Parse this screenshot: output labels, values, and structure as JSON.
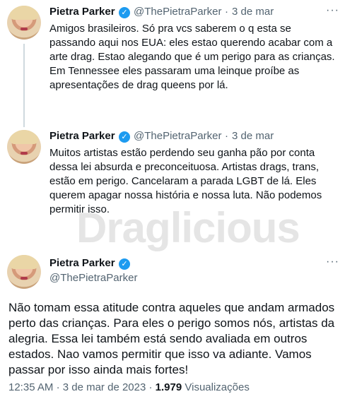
{
  "tweets": [
    {
      "name": "Pietra Parker",
      "handle": "@ThePietraParker",
      "separator": "·",
      "date": "3 de mar",
      "text": "Amigos brasileiros. Só pra vcs saberem o q esta se passando aqui nos EUA: eles estao querendo acabar com a arte drag. Estao alegando que é um perigo para as crianças. Em Tennessee eles passaram uma leinque proíbe as apresentações de drag queens por lá."
    },
    {
      "name": "Pietra Parker",
      "handle": "@ThePietraParker",
      "separator": "·",
      "date": "3 de mar",
      "text": "Muitos artistas estão perdendo seu ganha pão por conta dessa lei absurda e preconceituosa. Artistas drags, trans, estão em perigo. Cancelaram a parada LGBT de lá. Eles querem apagar nossa história e nossa luta. Não podemos permitir isso."
    },
    {
      "name": "Pietra Parker",
      "handle": "@ThePietraParker",
      "text": "Não tomam essa atitude contra aqueles que andam armados perto das crianças. Para eles o perigo somos nós, artistas da alegria. Essa lei também está sendo avaliada em outros estados. Nao vamos permitir que isso va adiante. Vamos passar por isso ainda mais fortes!"
    }
  ],
  "watermark": "Draglicious",
  "meta": {
    "time": "12:35 AM",
    "separator": "·",
    "date": "3 de mar de 2023",
    "views_count": "1.979",
    "views_label": "Visualizações"
  },
  "icons": {
    "verified": "verified-badge-icon",
    "more": "more-options-icon"
  },
  "colors": {
    "verified": "#1d9bf0",
    "secondary_text": "#536471",
    "thread_line": "#cfd9de"
  }
}
